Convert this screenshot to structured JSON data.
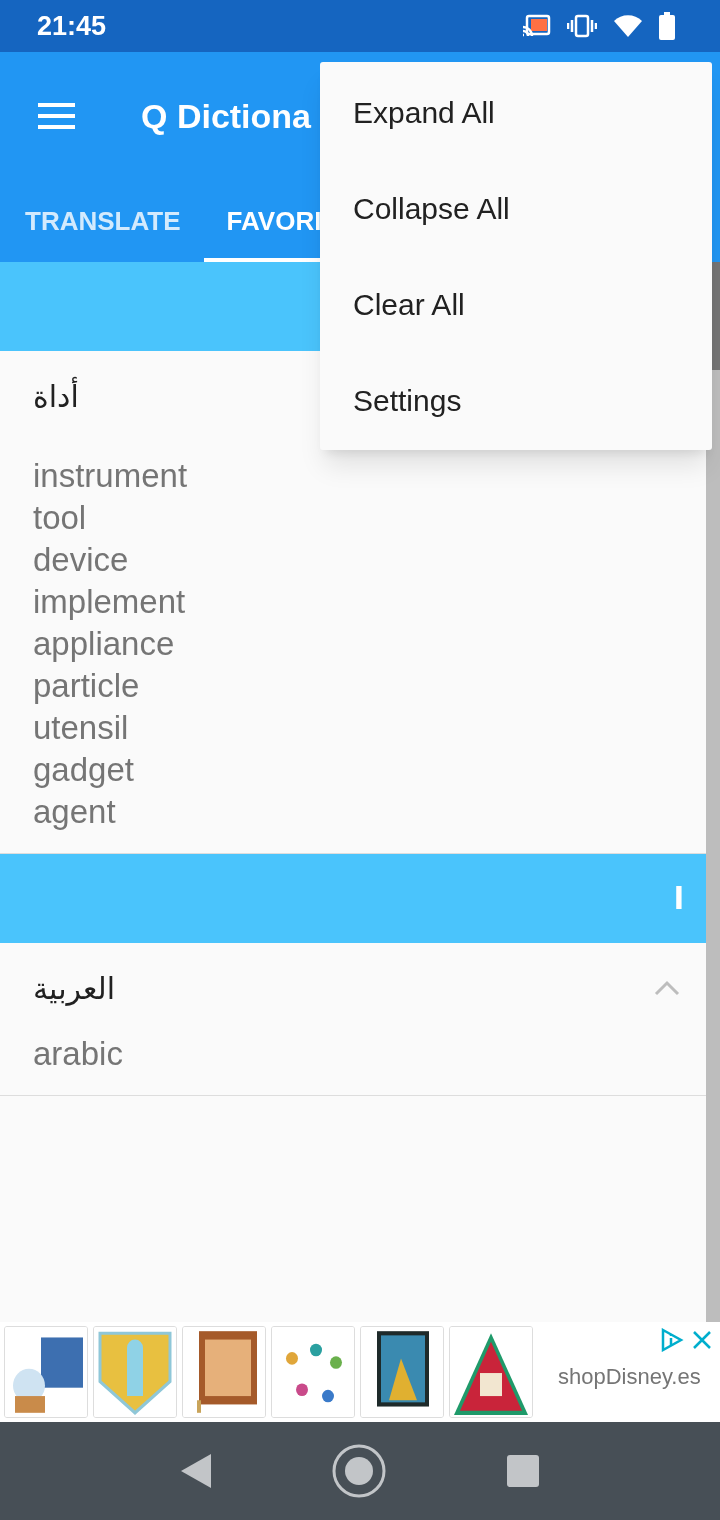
{
  "status_bar": {
    "time": "21:45"
  },
  "app_bar": {
    "title": "Q Dictiona"
  },
  "tabs": [
    {
      "label": "TRANSLATE",
      "selected": false
    },
    {
      "label": "FAVORI",
      "selected": true
    }
  ],
  "sections": [
    {
      "entries": [
        {
          "word": "أداة",
          "translations": [
            "instrument",
            "tool",
            "device",
            "implement",
            "appliance",
            "particle",
            "utensil",
            "gadget",
            "agent"
          ]
        }
      ]
    },
    {
      "letter": "ا",
      "entries": [
        {
          "word": "العربية",
          "expanded": true,
          "translations": [
            "arabic"
          ]
        }
      ]
    }
  ],
  "menu": {
    "items": [
      "Expand All",
      "Collapse All",
      "Clear All",
      "Settings"
    ]
  },
  "ad": {
    "advertiser": "shopDisney.es"
  }
}
